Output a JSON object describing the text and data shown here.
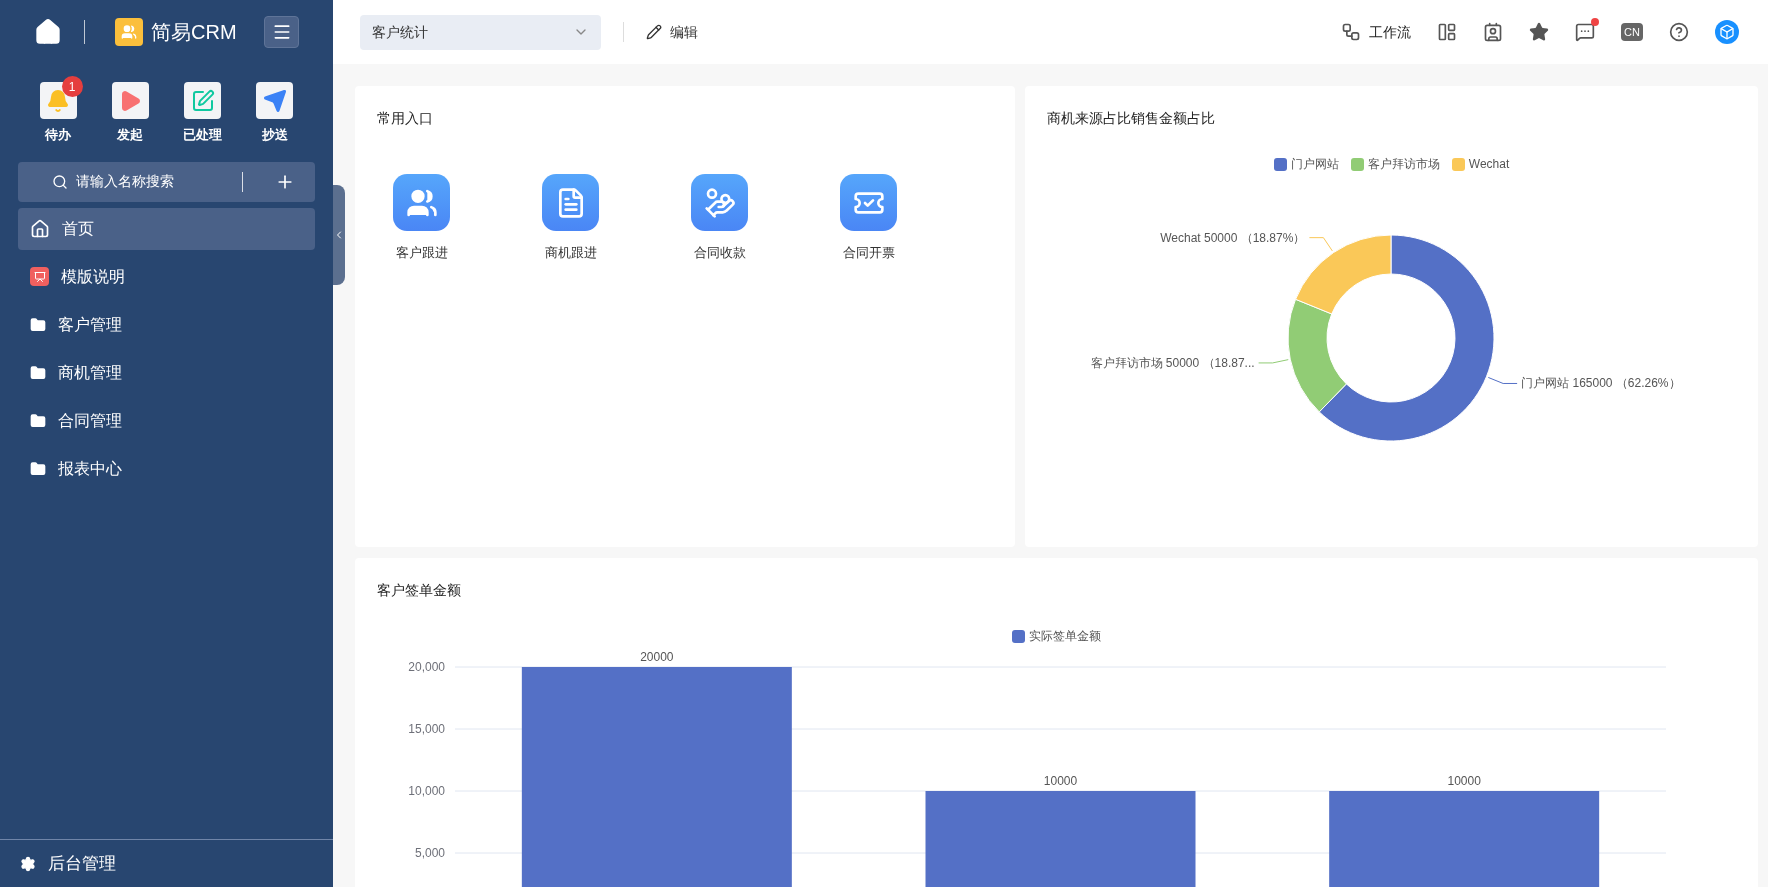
{
  "sidebar": {
    "brand": "简易CRM",
    "quick_actions": [
      {
        "label": "待办",
        "kind": "bell",
        "badge": "1"
      },
      {
        "label": "发起",
        "kind": "play"
      },
      {
        "label": "已处理",
        "kind": "done"
      },
      {
        "label": "抄送",
        "kind": "send"
      }
    ],
    "search": {
      "placeholder": "请输入名称搜索"
    },
    "items": [
      {
        "label": "首页",
        "kind": "home",
        "selected": true
      },
      {
        "label": "模版说明",
        "kind": "template",
        "selected": false
      },
      {
        "label": "客户管理",
        "kind": "folder",
        "selected": false
      },
      {
        "label": "商机管理",
        "kind": "folder",
        "selected": false
      },
      {
        "label": "合同管理",
        "kind": "folder",
        "selected": false
      },
      {
        "label": "报表中心",
        "kind": "folder",
        "selected": false
      }
    ],
    "footer": {
      "label": "后台管理"
    }
  },
  "header": {
    "dropdown": "客户统计",
    "edit": "编辑",
    "workflow": "工作流",
    "tools": [
      {
        "kind": "layout"
      },
      {
        "kind": "contacts"
      },
      {
        "kind": "star"
      },
      {
        "kind": "messages",
        "dot": true
      },
      {
        "kind": "language",
        "label": "CN"
      },
      {
        "kind": "help"
      },
      {
        "kind": "avatar"
      }
    ]
  },
  "shortcuts_card": {
    "title": "常用入口",
    "items": [
      {
        "label": "客户跟进",
        "kind": "customers"
      },
      {
        "label": "商机跟进",
        "kind": "opportunity"
      },
      {
        "label": "合同收款",
        "kind": "payment"
      },
      {
        "label": "合同开票",
        "kind": "invoice"
      }
    ]
  },
  "source_card": {
    "title": "商机来源占比销售金额占比",
    "chart_data": {
      "type": "donut",
      "categories": [
        "门户网站",
        "客户拜访市场",
        "Wechat"
      ],
      "values": [
        165000,
        50000,
        50000
      ],
      "colors": [
        "#5470c6",
        "#91cc75",
        "#fac858"
      ],
      "value_labels": [
        "门户网站 165000 （62.26%）",
        "客户拜访市场 50000 （18.87...",
        "Wechat 50000 （18.87%）"
      ]
    }
  },
  "amount_card": {
    "title": "客户签单金额",
    "chart_data": {
      "type": "bar",
      "series": [
        {
          "name": "实际签单金额",
          "color": "#5470c6",
          "values": [
            20000,
            10000,
            10000
          ]
        }
      ],
      "ylim": [
        0,
        20000
      ],
      "yticks": [
        {
          "value": 5000,
          "label": "5,000"
        },
        {
          "value": 10000,
          "label": "10,000"
        },
        {
          "value": 15000,
          "label": "15,000"
        },
        {
          "value": 20000,
          "label": "20,000"
        }
      ],
      "grid": true,
      "data_labels": true
    }
  }
}
